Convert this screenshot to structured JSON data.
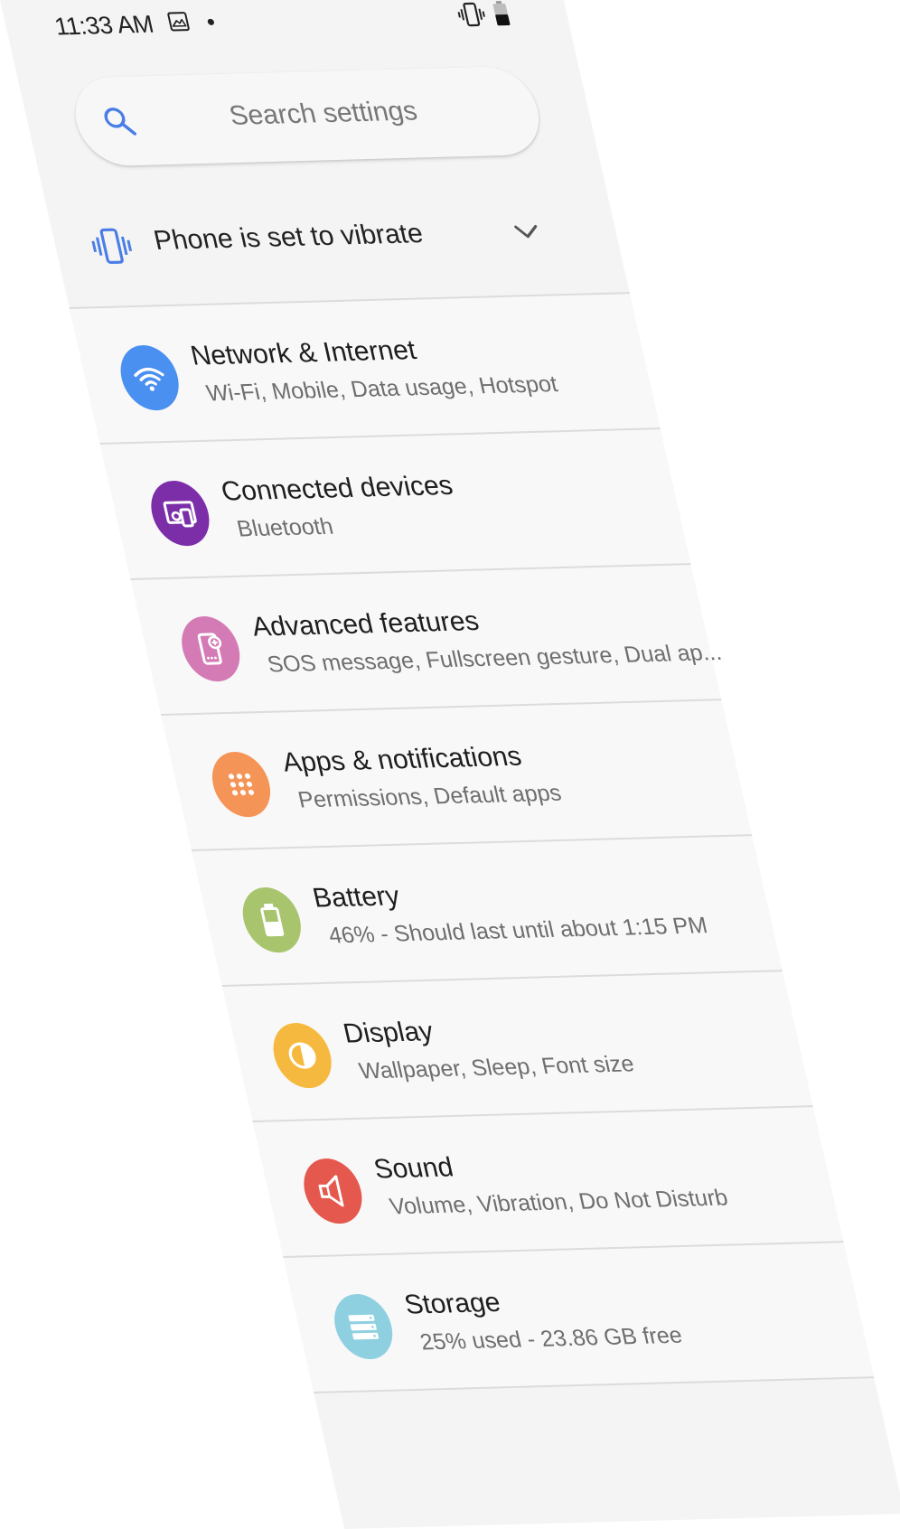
{
  "status_bar": {
    "time": "11:33 AM",
    "icons": [
      "image-icon",
      "notification-dot",
      "vibrate-icon",
      "battery-icon"
    ]
  },
  "search": {
    "placeholder": "Search settings"
  },
  "vibrate_banner": {
    "text": "Phone is set to vibrate",
    "icon": "vibrate-icon"
  },
  "settings": [
    {
      "title": "Network & Internet",
      "subtitle": "Wi-Fi, Mobile, Data usage, Hotspot",
      "icon": "wifi-icon",
      "color": "#4a90f0"
    },
    {
      "title": "Connected devices",
      "subtitle": "Bluetooth",
      "icon": "connected-devices-icon",
      "color": "#7b2ea8"
    },
    {
      "title": "Advanced features",
      "subtitle": "SOS message, Fullscreen gesture, Dual ap...",
      "icon": "advanced-features-icon",
      "color": "#d47bb6"
    },
    {
      "title": "Apps & notifications",
      "subtitle": "Permissions, Default apps",
      "icon": "apps-icon",
      "color": "#f59457"
    },
    {
      "title": "Battery",
      "subtitle": "46% - Should last until about 1:15 PM",
      "icon": "battery-icon",
      "color": "#a8c46c"
    },
    {
      "title": "Display",
      "subtitle": "Wallpaper, Sleep, Font size",
      "icon": "display-icon",
      "color": "#f6b93f"
    },
    {
      "title": "Sound",
      "subtitle": "Volume, Vibration, Do Not Disturb",
      "icon": "sound-icon",
      "color": "#e5584e"
    },
    {
      "title": "Storage",
      "subtitle": "25% used - 23.86 GB free",
      "icon": "storage-icon",
      "color": "#8fd0e0"
    }
  ],
  "colors": {
    "accent": "#4a7de6",
    "background": "#f4f4f4"
  }
}
